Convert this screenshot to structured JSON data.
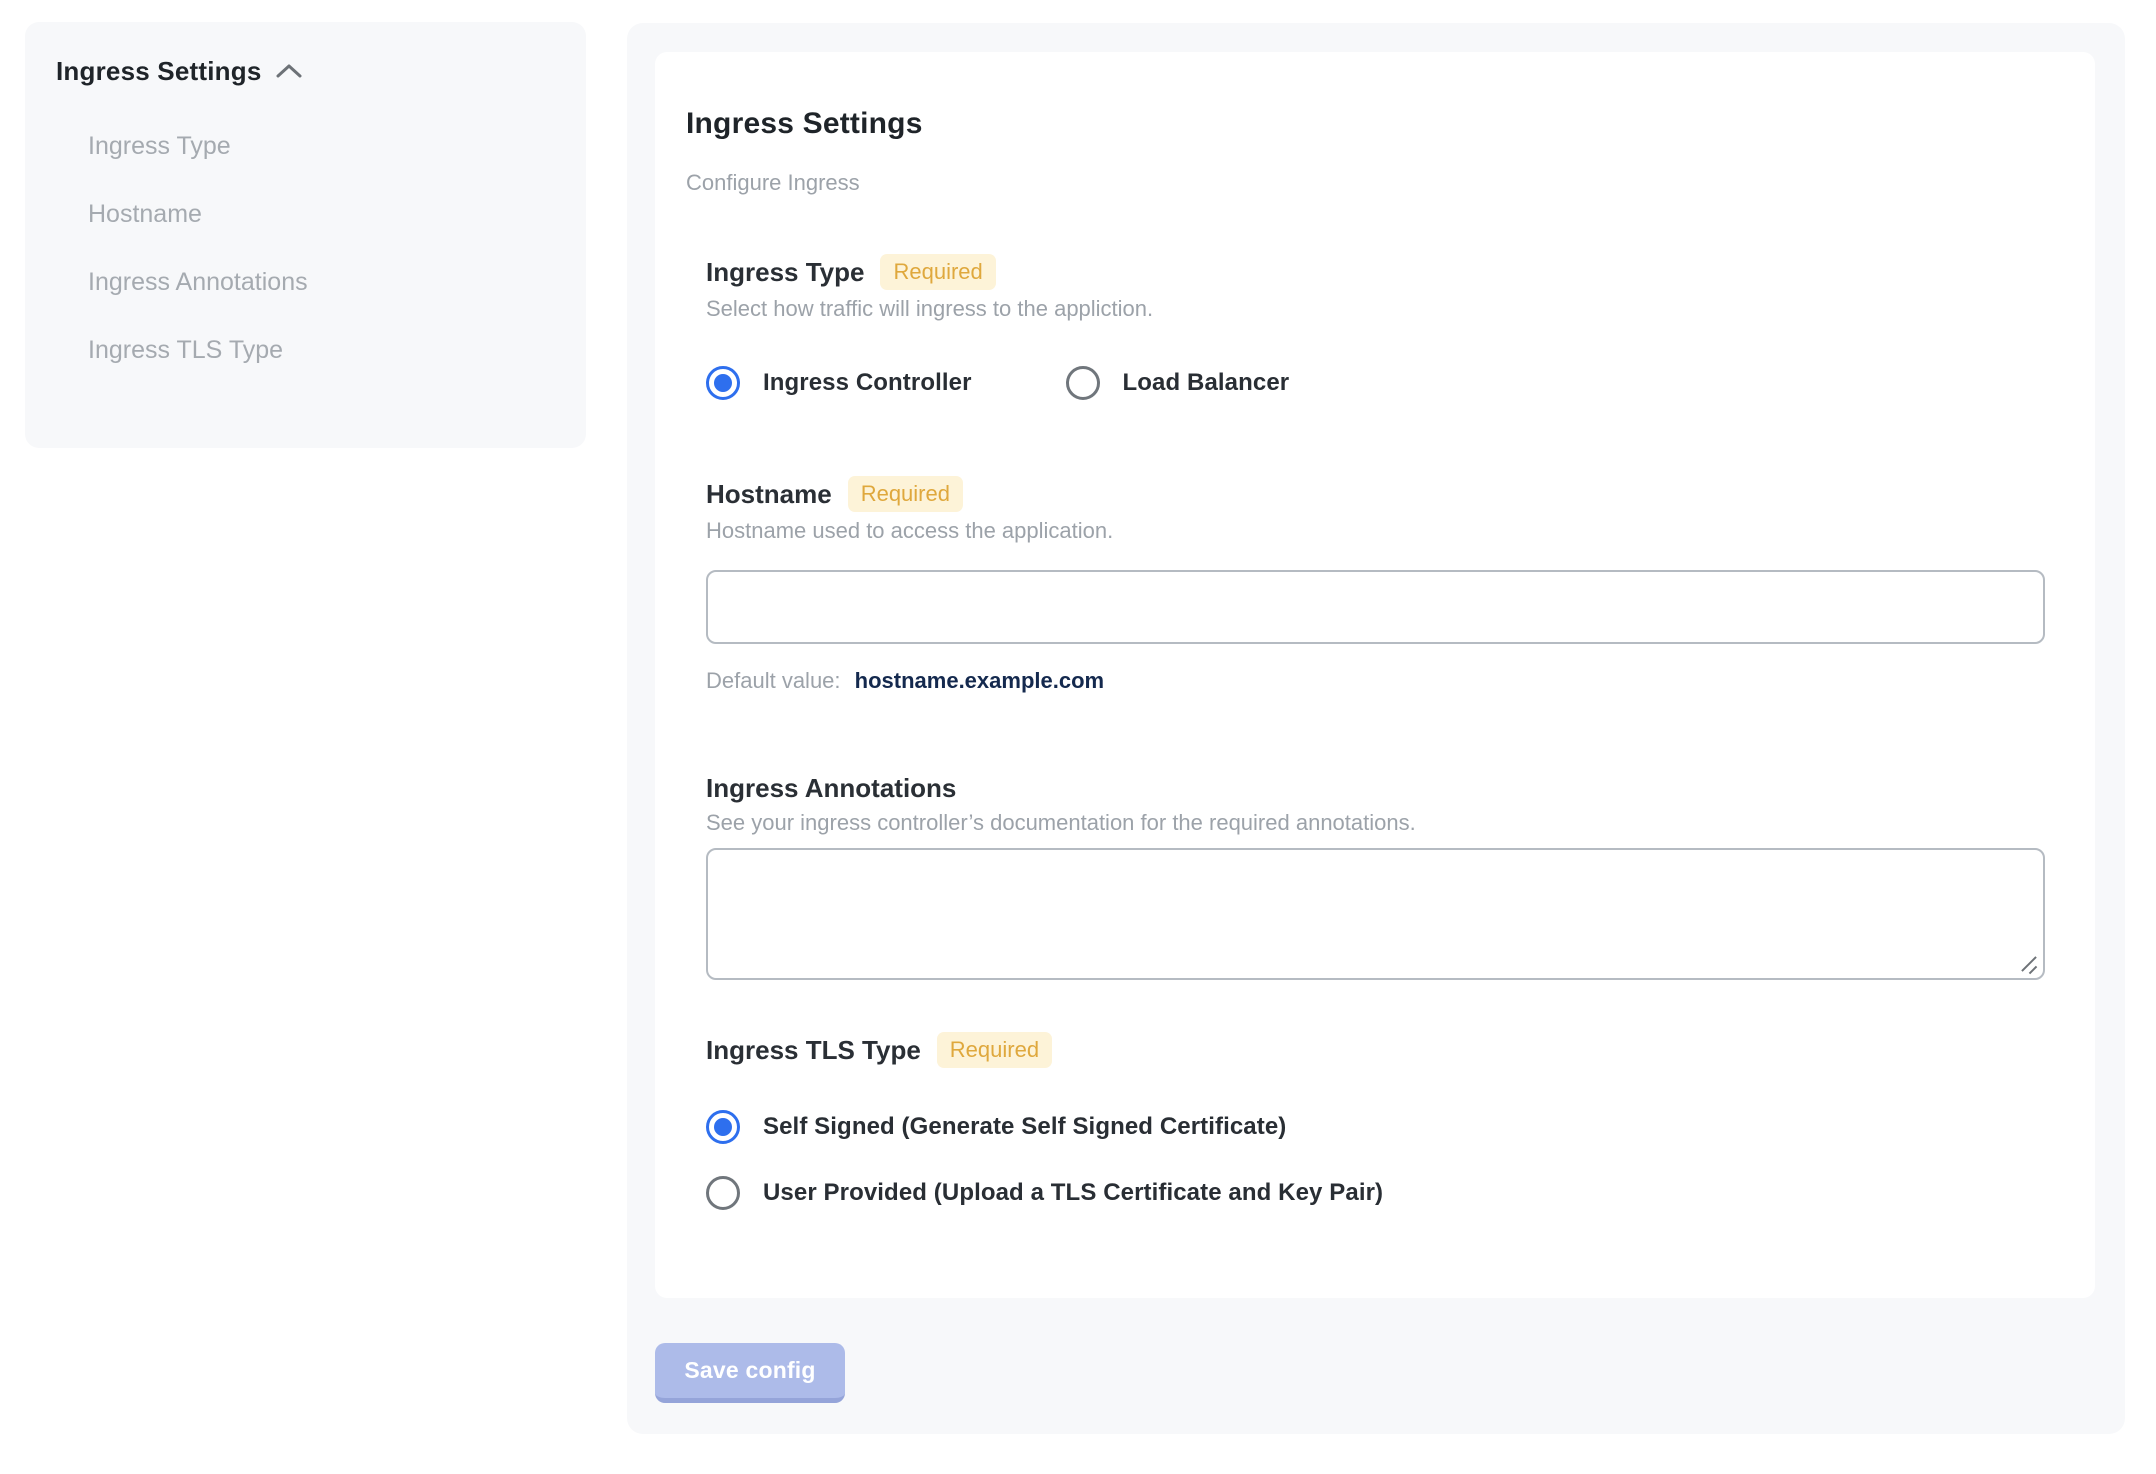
{
  "colors": {
    "panel_bg": "#f7f8fa",
    "accent_blue": "#2e6fee",
    "badge_bg": "#fdf3d8",
    "badge_text": "#dfa83d",
    "muted_text": "#9ca2a9",
    "default_value_text": "#14294e",
    "save_button_bg": "#adbbe9"
  },
  "sidebar": {
    "title": "Ingress Settings",
    "collapse_icon": "chevron-up-icon",
    "items": [
      {
        "label": "Ingress Type"
      },
      {
        "label": "Hostname"
      },
      {
        "label": "Ingress Annotations"
      },
      {
        "label": "Ingress TLS Type"
      }
    ]
  },
  "main": {
    "title": "Ingress Settings",
    "subtitle": "Configure Ingress",
    "fields": {
      "ingress_type": {
        "label": "Ingress Type",
        "required_badge": "Required",
        "description": "Select how traffic will ingress to the appliction.",
        "options": [
          {
            "label": "Ingress Controller",
            "selected": true
          },
          {
            "label": "Load Balancer",
            "selected": false
          }
        ]
      },
      "hostname": {
        "label": "Hostname",
        "required_badge": "Required",
        "description": "Hostname used to access the application.",
        "value": "",
        "helper_prefix": "Default value:",
        "helper_value": "hostname.example.com"
      },
      "ingress_annotations": {
        "label": "Ingress Annotations",
        "description": "See your ingress controller’s documentation for the required annotations.",
        "value": ""
      },
      "ingress_tls_type": {
        "label": "Ingress TLS Type",
        "required_badge": "Required",
        "options": [
          {
            "label": "Self Signed (Generate Self Signed Certificate)",
            "selected": true
          },
          {
            "label": "User Provided (Upload a TLS Certificate and Key Pair)",
            "selected": false
          }
        ]
      }
    },
    "save_button": "Save config"
  }
}
